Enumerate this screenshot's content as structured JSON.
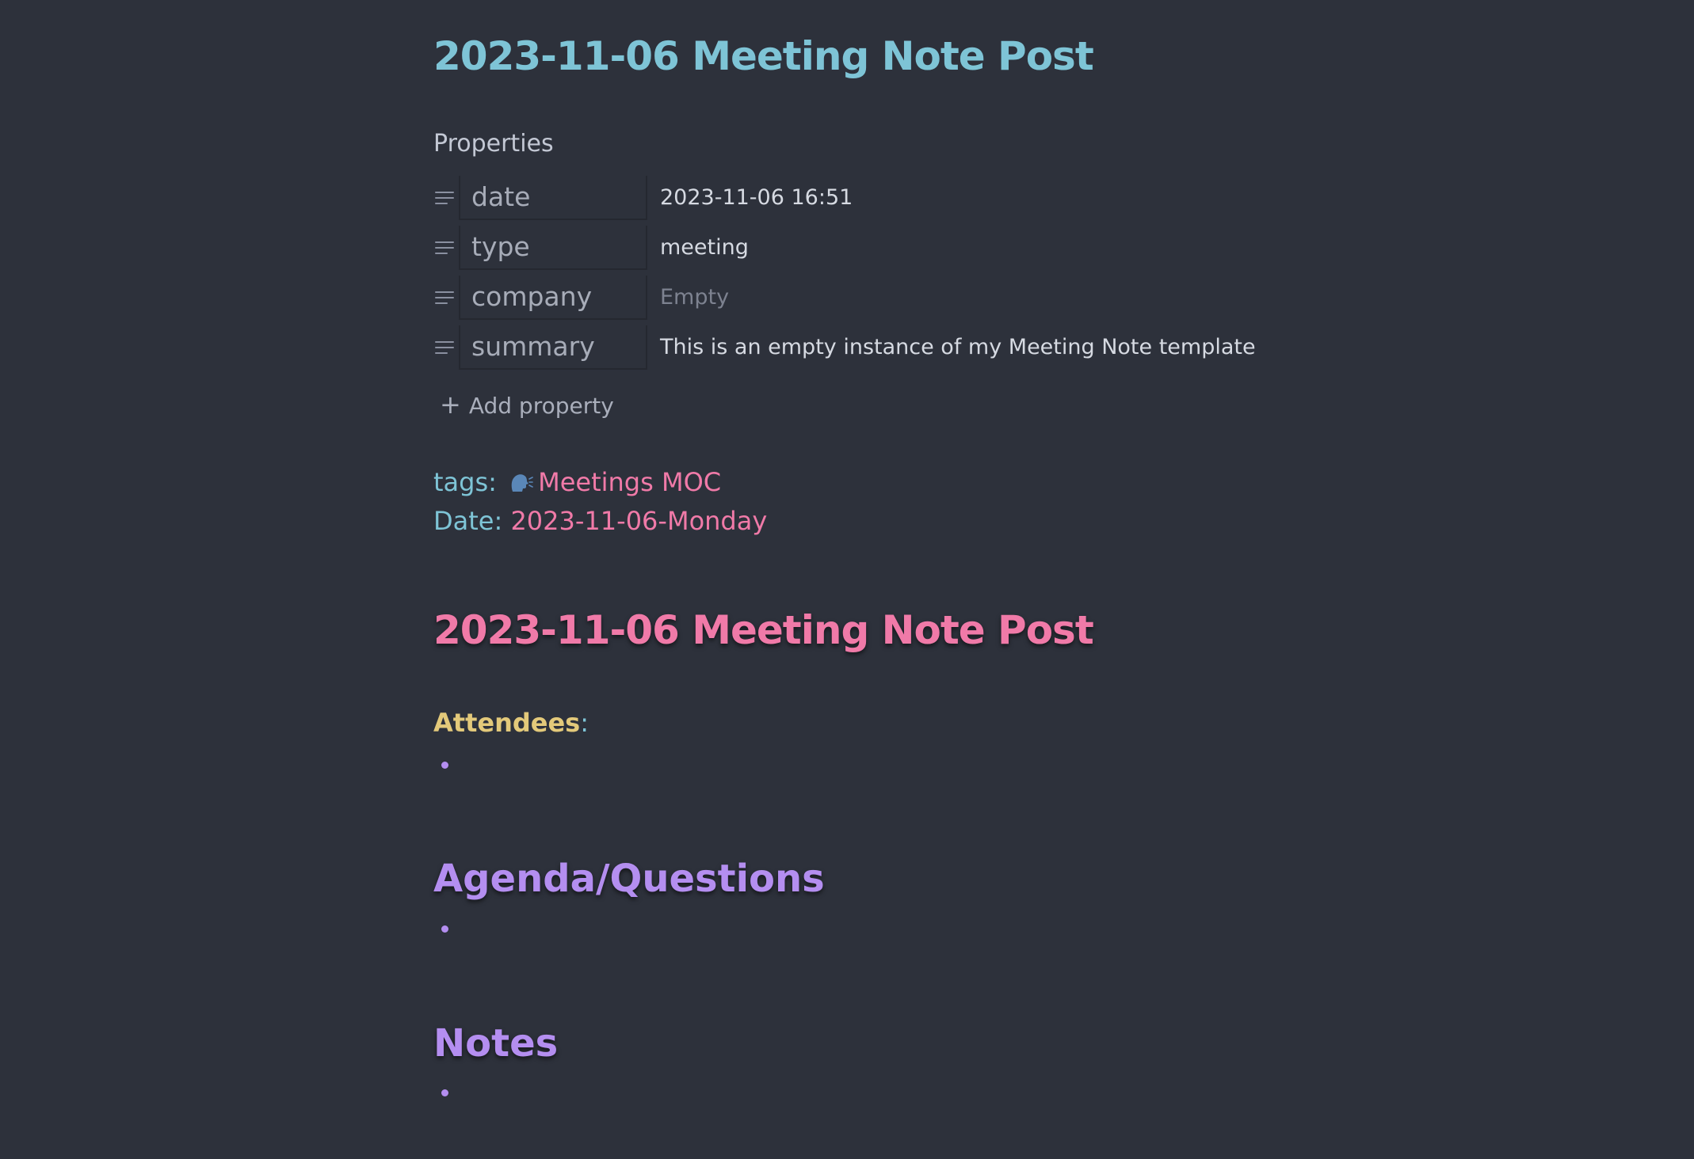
{
  "note": {
    "title": "2023-11-06 Meeting Note Post"
  },
  "properties": {
    "heading": "Properties",
    "items": [
      {
        "key": "date",
        "value": "2023-11-06 16:51"
      },
      {
        "key": "type",
        "value": "meeting"
      },
      {
        "key": "company",
        "value": "Empty"
      },
      {
        "key": "summary",
        "value": "This is an empty instance of my Meeting Note template"
      }
    ],
    "add_label": "Add property",
    "add_icon": "plus-icon"
  },
  "meta": {
    "tags_label": "tags:",
    "tags_icon": "speaking-head-icon",
    "tags_link": "Meetings MOC",
    "date_label": "Date:",
    "date_link": "2023-11-06-Monday"
  },
  "body": {
    "heading": "2023-11-06 Meeting Note Post",
    "attendees_label": "Attendees",
    "attendees_colon": ":",
    "agenda_heading": "Agenda/Questions",
    "notes_heading": "Notes"
  },
  "colors": {
    "background": "#2d313b",
    "title_cyan": "#7ec4d6",
    "link_pink": "#f07aa8",
    "heading_purple": "#b48ef0",
    "bold_yellow": "#e3c97a"
  }
}
